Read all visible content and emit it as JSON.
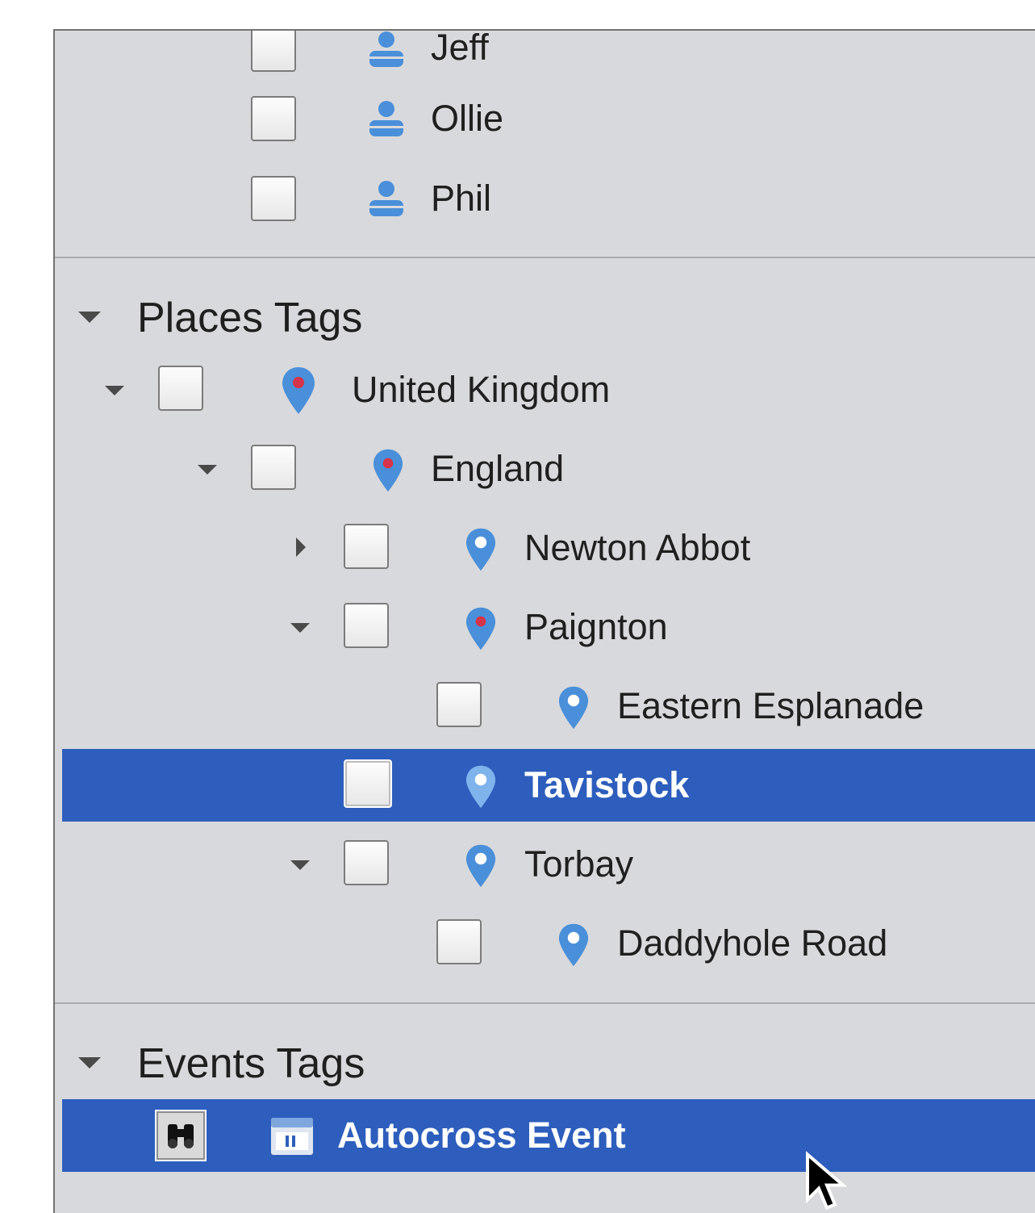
{
  "people": {
    "items": [
      {
        "label": "Jeff"
      },
      {
        "label": "Ollie"
      },
      {
        "label": "Phil"
      }
    ]
  },
  "places": {
    "header": "Places Tags",
    "items": [
      {
        "label": "United Kingdom",
        "expanded": true,
        "pin": "red-dot"
      },
      {
        "label": "England",
        "expanded": true,
        "pin": "red-dot"
      },
      {
        "label": "Newton Abbot",
        "expanded": false,
        "pin": "plain"
      },
      {
        "label": "Paignton",
        "expanded": true,
        "pin": "red-dot"
      },
      {
        "label": "Eastern Esplanade",
        "pin": "plain"
      },
      {
        "label": "Tavistock",
        "pin": "plain",
        "selected": true
      },
      {
        "label": "Torbay",
        "expanded": true,
        "pin": "plain"
      },
      {
        "label": "Daddyhole Road",
        "pin": "plain"
      }
    ]
  },
  "events": {
    "header": "Events Tags",
    "items": [
      {
        "label": "Autocross Event",
        "selected": true,
        "icon": "binoculars-icon"
      }
    ]
  },
  "colors": {
    "panel_background": "#d8d9dc",
    "selection": "#2d5ebd",
    "pin_blue": "#4a8fd9",
    "pin_dot_red": "#d6344a",
    "person_blue": "#4a8fd9"
  }
}
